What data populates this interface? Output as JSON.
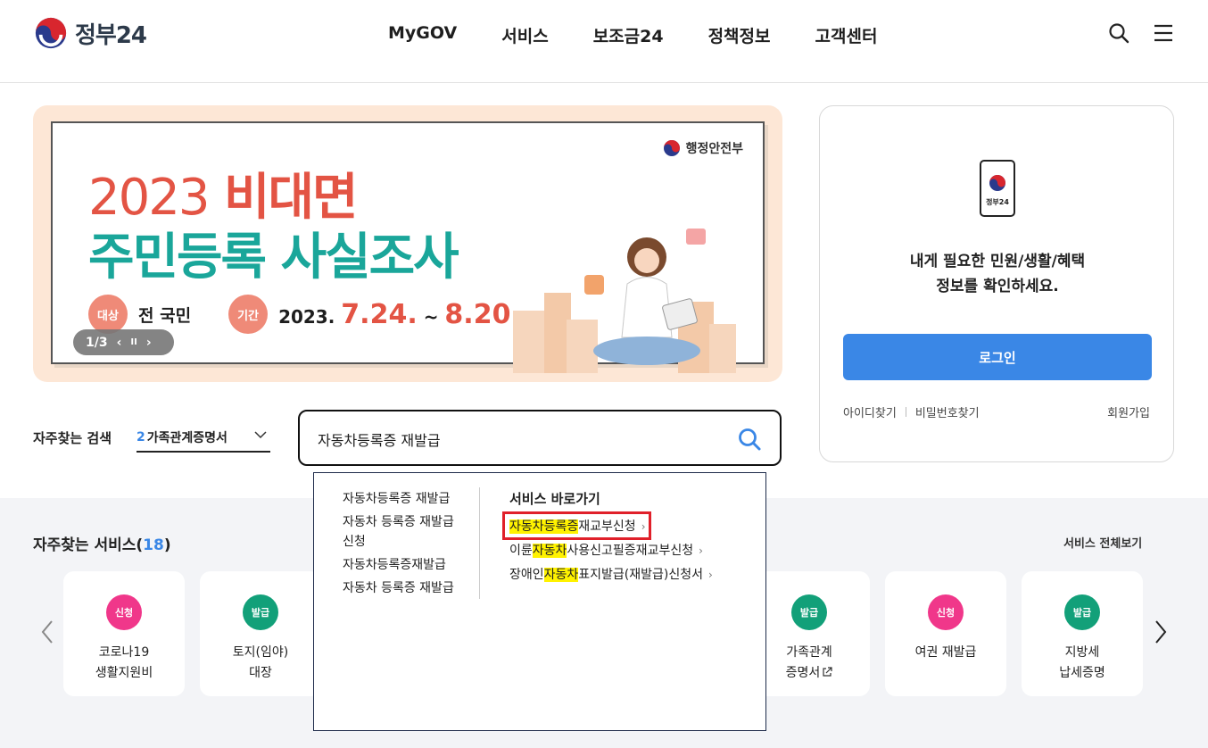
{
  "header": {
    "logo_text": "정부24",
    "nav": [
      "MyGOV",
      "서비스",
      "보조금24",
      "정책정보",
      "고객센터"
    ],
    "icons": [
      "search-icon",
      "menu-icon"
    ]
  },
  "banner": {
    "ministry": "행정안전부",
    "year": "2023",
    "headline1": "비대면",
    "headline2": "주민등록 사실조사",
    "target_label": "대상",
    "target_value": "전 국민",
    "period_label": "기간",
    "date_prefix": "2023.",
    "date_start": "7.24.",
    "date_sep": "~",
    "date_end": "8.20.",
    "pager": "1/3",
    "prev": "‹",
    "pause": "II",
    "next": "›"
  },
  "login": {
    "phone_label": "정부24",
    "message_line1": "내게 필요한 민원/생활/혜택",
    "message_line2": "정보를 확인하세요.",
    "login_button": "로그인",
    "find_id": "아이디찾기",
    "find_pw": "비밀번호찾기",
    "signup": "회원가입"
  },
  "search": {
    "frequent_label": "자주찾는 검색",
    "select_num": "2",
    "select_text": "가족관계증명서",
    "query": "자동차등록증 재발급"
  },
  "dropdown": {
    "suggestions": [
      "자동차등록증 재발급",
      "자동차 등록증 재발급 신청",
      "자동차등록증재발급",
      "자동차 등록증 재발급"
    ],
    "quick_title": "서비스 바로가기",
    "quick_links": [
      {
        "pre": "",
        "hl": "자동차등록증",
        "post": "재교부신청"
      },
      {
        "pre": "이륜",
        "hl": "자동차",
        "post": "사용신고필증재교부신청"
      },
      {
        "pre": "장애인",
        "hl": "자동차",
        "post": "표지발급(재발급)신청서"
      }
    ],
    "arrow": "›"
  },
  "services": {
    "title": "자주찾는 서비스(",
    "count": "18",
    "title_end": ")",
    "view_all": "서비스 전체보기",
    "cards": [
      {
        "badge": "신청",
        "type": "apply",
        "line1": "코로나19",
        "line2": "생활지원비"
      },
      {
        "badge": "발급",
        "type": "issue",
        "line1": "토지(임야)",
        "line2": "대장"
      },
      {
        "badge": "발급",
        "type": "issue",
        "line1": "가족관계",
        "line2": "증명서"
      },
      {
        "badge": "신청",
        "type": "apply",
        "line1": "여권 재발급",
        "line2": ""
      },
      {
        "badge": "발급",
        "type": "issue",
        "line1": "지방세",
        "line2": "납세증명"
      }
    ]
  },
  "colors": {
    "accent_blue": "#3a87e6",
    "banner_red": "#e35444",
    "banner_teal": "#1aa69a",
    "apply_pink": "#f0378a",
    "issue_green": "#12a079",
    "highlight_yellow": "#fff200",
    "annotation_red": "#e0202a"
  }
}
